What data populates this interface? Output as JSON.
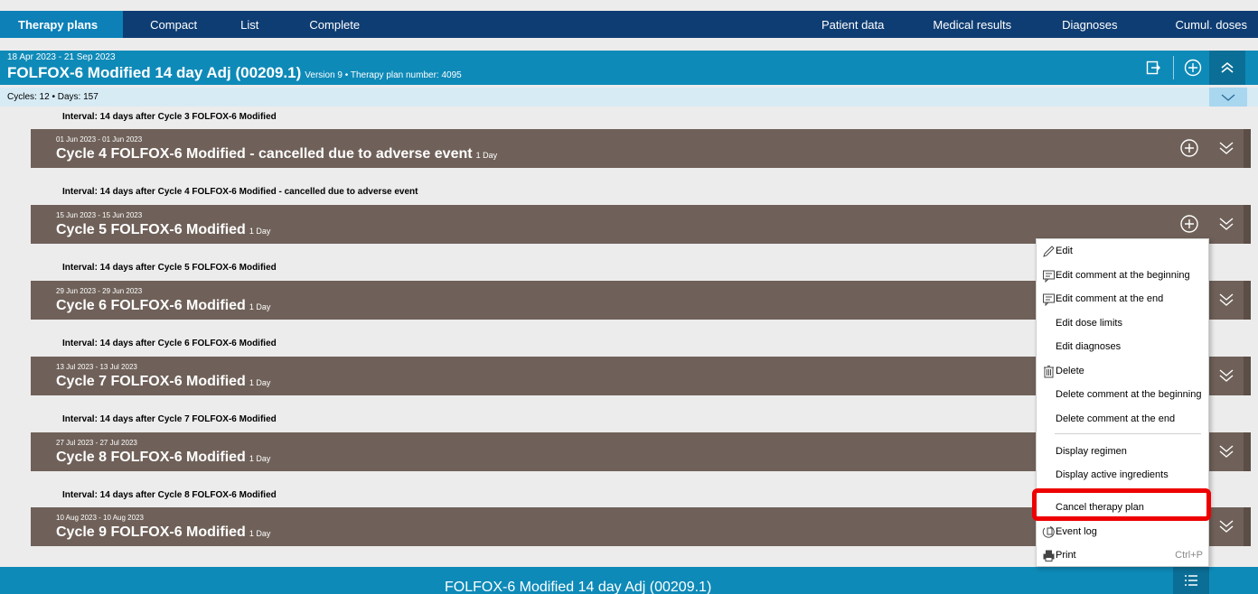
{
  "nav": {
    "left_tabs": [
      "Therapy plans",
      "Compact",
      "List",
      "Complete"
    ],
    "right_tabs": [
      "Patient data",
      "Medical results",
      "Diagnoses",
      "Cumul. doses"
    ]
  },
  "plan": {
    "dates": "18 Apr 2023 - 21 Sep 2023",
    "title": "FOLFOX-6 Modified 14 day Adj (00209.1)",
    "subtitle": "Version 9 • Therapy plan number: 4095"
  },
  "cycles_summary": "Cycles: 12 • Days: 157",
  "intervals": [
    "Interval: 14 days after Cycle 3 FOLFOX-6 Modified",
    "Interval: 14 days after Cycle 4 FOLFOX-6 Modified - cancelled due to adverse event",
    "Interval: 14 days after Cycle 5 FOLFOX-6 Modified",
    "Interval: 14 days after Cycle 6 FOLFOX-6 Modified",
    "Interval: 14 days after Cycle 7 FOLFOX-6 Modified",
    "Interval: 14 days after Cycle 8 FOLFOX-6 Modified"
  ],
  "cycles": [
    {
      "date": "01 Jun 2023 - 01 Jun 2023",
      "title": "Cycle 4 FOLFOX-6 Modified - cancelled due to adverse event",
      "days": "1 Day"
    },
    {
      "date": "15 Jun 2023 - 15 Jun 2023",
      "title": "Cycle 5 FOLFOX-6 Modified",
      "days": "1 Day"
    },
    {
      "date": "29 Jun 2023 - 29 Jun 2023",
      "title": "Cycle 6 FOLFOX-6 Modified",
      "days": "1 Day"
    },
    {
      "date": "13 Jul 2023 - 13 Jul 2023",
      "title": "Cycle 7 FOLFOX-6 Modified",
      "days": "1 Day"
    },
    {
      "date": "27 Jul 2023 - 27 Jul 2023",
      "title": "Cycle 8 FOLFOX-6 Modified",
      "days": "1 Day"
    },
    {
      "date": "10 Aug 2023 - 10 Aug 2023",
      "title": "Cycle 9 FOLFOX-6 Modified",
      "days": "1 Day"
    }
  ],
  "context_menu": {
    "items": [
      {
        "label": "Edit",
        "icon": "pencil-icon"
      },
      {
        "label": "Edit comment at the beginning",
        "icon": "comment-icon"
      },
      {
        "label": "Edit comment at the end",
        "icon": "comment-icon"
      },
      {
        "label": "Edit dose limits"
      },
      {
        "label": "Edit diagnoses"
      },
      {
        "label": "Delete",
        "icon": "trash-icon"
      },
      {
        "label": "Delete comment at the beginning"
      },
      {
        "label": "Delete comment at the end"
      },
      {
        "label": "Display regimen"
      },
      {
        "label": "Display active ingredients"
      },
      {
        "label": "Cancel therapy plan"
      },
      {
        "label": "Event log",
        "icon": "event-log-icon"
      },
      {
        "label": "Print",
        "icon": "printer-icon",
        "shortcut": "Ctrl+P"
      }
    ]
  },
  "bottom_title": "FOLFOX-6 Modified 14 day Adj (00209.1)",
  "colors": {
    "nav_bg": "#0e3d73",
    "active_tab": "#0d80b8",
    "plan_header": "#0e8ab8",
    "cycle_bg": "#6f6159",
    "highlight": "#ee0000"
  }
}
